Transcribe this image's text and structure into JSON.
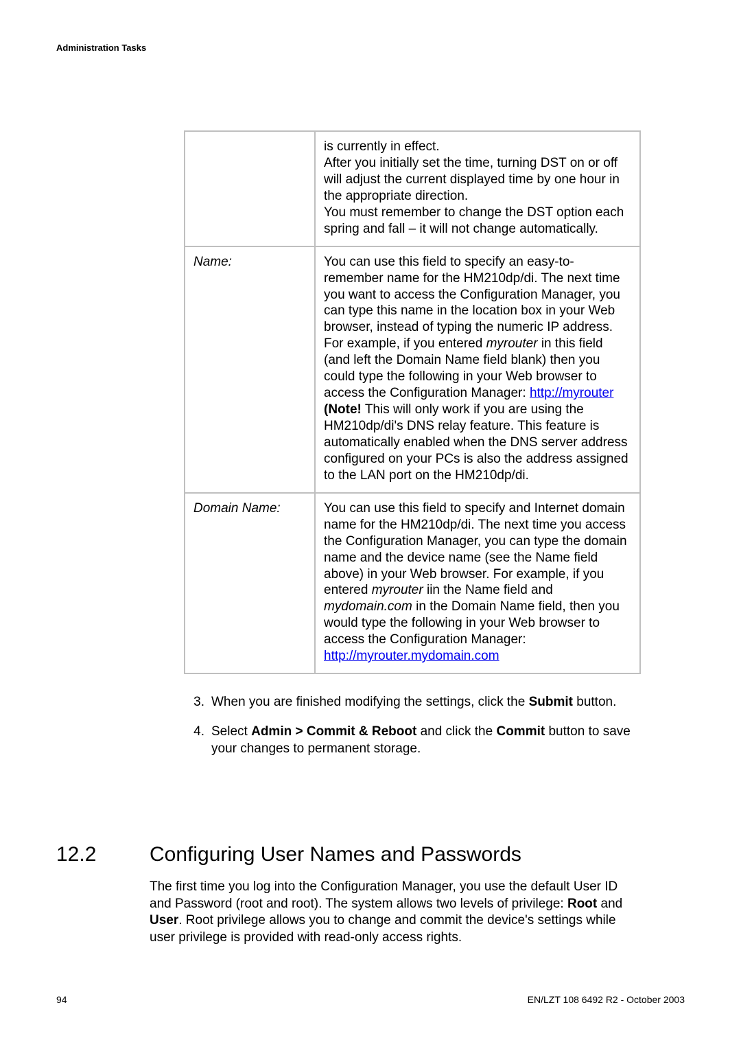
{
  "header": "Administration Tasks",
  "table": {
    "row0": {
      "desc_line1": "is currently in effect.",
      "desc_line2": "After you initially set the time, turning DST on or off will adjust the current displayed time by one hour in the appropriate direction.",
      "desc_line3": "You must remember to change the DST option each spring and fall – it will not change automatically."
    },
    "row1": {
      "label": "Name:",
      "desc_part1": "You can use this field to specify an easy-to-remember name for the HM210dp/di. The next time you want to access the Configuration Manager, you can type this name in the location box in your Web browser, instead of typing the numeric IP address. For example, if you entered ",
      "desc_italic1": "myrouter",
      "desc_part2": " in this field (and left the Domain Name field blank) then you could type the following in your Web browser to access the Configuration Manager: ",
      "link1": "http://myrouter",
      "desc_part3_prefix": "(Note!",
      "desc_part3": " This will only work if you are using the HM210dp/di's DNS relay feature. This feature is automatically enabled when the DNS server address configured on your PCs is also the address assigned to the LAN port on the HM210dp/di."
    },
    "row2": {
      "label": "Domain Name:",
      "desc_part1": "You can use this field to specify and Internet domain name for the HM210dp/di. The next time you access the Configuration Manager, you can type the domain name and the device name (see the Name field above) in your Web browser. For example, if you entered ",
      "desc_italic1": "myrouter",
      "desc_part2": " iin the Name field and ",
      "desc_italic2": "mydomain.com",
      "desc_part3": " in the Domain Name field, then you would type the following in your Web browser to access the Configuration Manager:",
      "link1": "http://myrouter.mydomain.com"
    }
  },
  "steps": {
    "s3": {
      "num": "3.",
      "t1": "When you are finished modifying the settings, click the ",
      "b1": "Submit",
      "t2": " button."
    },
    "s4": {
      "num": "4.",
      "t1": "Select ",
      "b1": "Admin > Commit & Reboot",
      "t2": " and click the ",
      "b2": "Commit",
      "t3": " button to save your changes to permanent storage."
    }
  },
  "section": {
    "num": "12.2",
    "title": "Configuring User Names and Passwords",
    "para_t1": "The first time you log into the Configuration Manager, you use the default User ID and Password (root and root). The system allows two levels of privilege: ",
    "para_b1": "Root",
    "para_t2": " and ",
    "para_b2": "User",
    "para_t3": ". Root privilege allows you to change and commit the device's settings while user privilege is provided with read-only access rights."
  },
  "footer": {
    "page": "94",
    "right": "EN/LZT 108 6492 R2  -  October 2003"
  }
}
